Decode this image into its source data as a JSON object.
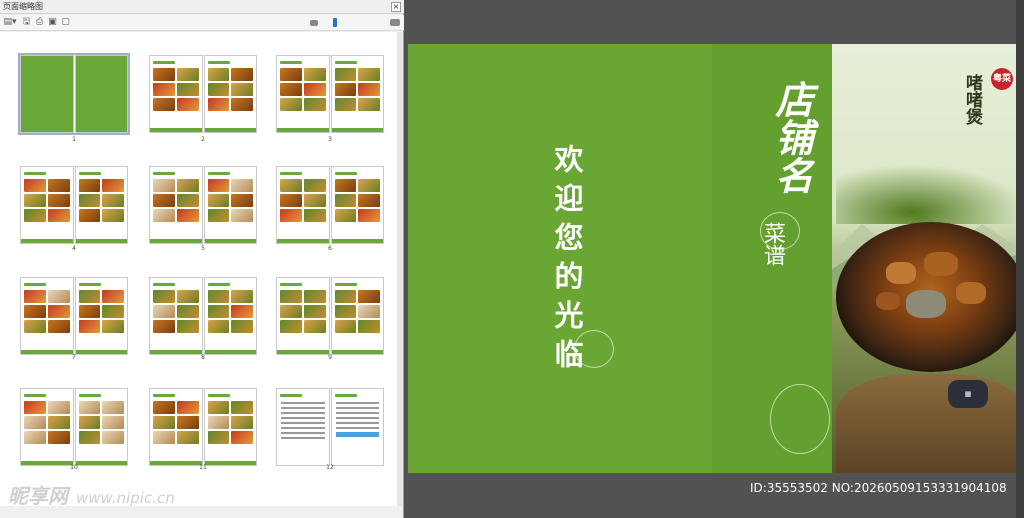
{
  "panel": {
    "title": "页面缩略图",
    "close": "×",
    "toolbar": [
      "▤▾",
      "🖫",
      "⎙",
      "▣",
      "▢"
    ],
    "page_labels": [
      "1",
      "2",
      "3",
      "4",
      "5",
      "6",
      "7",
      "8",
      "9",
      "10",
      "11",
      "12"
    ]
  },
  "cover": {
    "back_text": "欢迎您的光临",
    "shop_name": "店铺名",
    "menu_label": "菜谱",
    "seal_text": "粤菜",
    "dish_title": "啫啫煲"
  },
  "footer": {
    "id_text": "ID:35553502 NO:20260509153331904108",
    "watermark_brand": "昵享网",
    "watermark_url": "www.nipic.cn"
  },
  "colors": {
    "cover_green": "#69a633",
    "panel_bg": "#f0f0f0",
    "canvas_bg": "#525252"
  }
}
